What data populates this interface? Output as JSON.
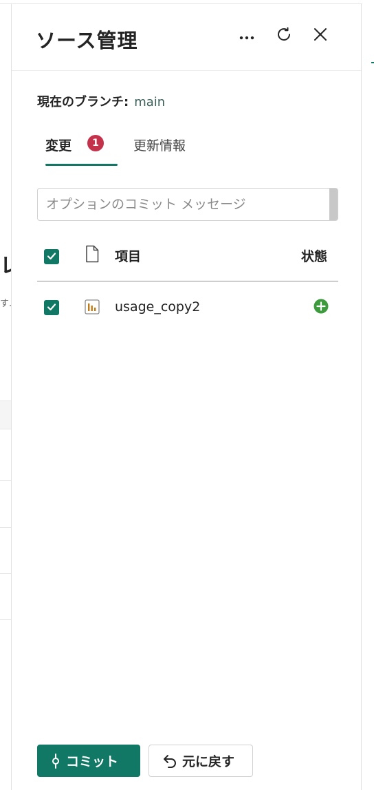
{
  "panel": {
    "title": "ソース管理",
    "more_icon": "more-horizontal-icon",
    "refresh_icon": "refresh-icon",
    "close_icon": "close-icon"
  },
  "branch": {
    "label": "現在のブランチ:",
    "value": "main"
  },
  "tabs": {
    "changes_label": "変更",
    "changes_count": "1",
    "updates_label": "更新情報"
  },
  "commit_message": {
    "value": "",
    "placeholder": "オプションのコミット メッセージ"
  },
  "table": {
    "header_item": "項目",
    "header_status": "状態",
    "rows": [
      {
        "name": "usage_copy2",
        "icon": "report-icon",
        "status_icon": "added-icon",
        "checked": true
      }
    ]
  },
  "footer": {
    "commit_label": "コミット",
    "revert_label": "元に戻す"
  },
  "background": {
    "partial_heading": "レ",
    "partial_text": "す."
  },
  "colors": {
    "accent": "#117865",
    "badge": "#c4314b",
    "added": "#3d9b3d"
  }
}
